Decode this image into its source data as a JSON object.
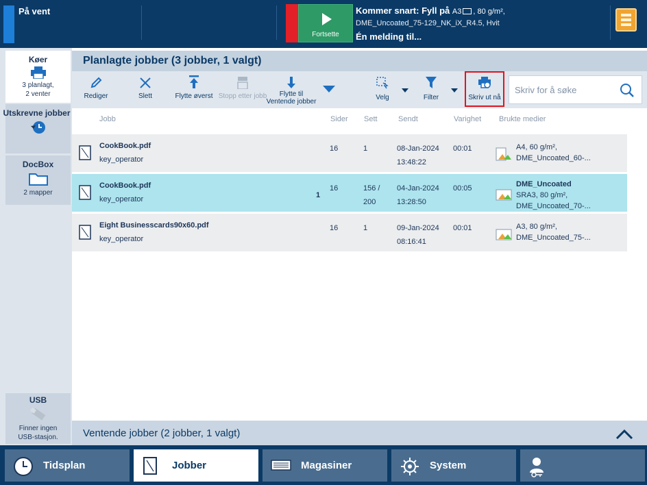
{
  "status": {
    "title": "På vent"
  },
  "printer": {
    "continue_label": "Fortsette",
    "msg_prefix": "Kommer snart: Fyll på",
    "msg_paper": "A3",
    "msg_spec": ", 80 g/m²,",
    "msg_line2": "DME_Uncoated_75-129_NK_iX_R4.5, Hvit",
    "msg_line3": "Én melding til..."
  },
  "sidebar": {
    "queues": {
      "title": "Køer",
      "sub1": "3 planlagt,",
      "sub2": "2 venter"
    },
    "printed": {
      "title": "Utskrevne jobber"
    },
    "docbox": {
      "title": "DocBox",
      "sub": "2 mapper"
    },
    "usb": {
      "title": "USB",
      "sub1": "Finner ingen",
      "sub2": "USB-stasjon."
    }
  },
  "panel": {
    "title": "Planlagte jobber (3 jobber, 1 valgt)"
  },
  "toolbar": {
    "edit": "Rediger",
    "delete": "Slett",
    "move_top": "Flytte øverst",
    "stop_after": "Stopp etter jobb",
    "move_to_1": "Flytte til",
    "move_to_2": "Ventende jobber",
    "select": "Velg",
    "filter": "Filter",
    "print_now": "Skriv ut nå"
  },
  "search": {
    "placeholder": "Skriv for å søke"
  },
  "columns": {
    "job": "Jobb",
    "pages": "Sider",
    "sets": "Sett",
    "sent": "Sendt",
    "duration": "Varighet",
    "media": "Brukte medier"
  },
  "jobs": [
    {
      "name": "CookBook.pdf",
      "owner": "key_operator",
      "count": "",
      "pages": "16",
      "sets": "1",
      "sets2": "",
      "date": "08-Jan-2024",
      "time": "13:48:22",
      "duration": "00:01",
      "media_bold": "",
      "media1": "A4, 60 g/m²,",
      "media2": "DME_Uncoated_60-..."
    },
    {
      "name": "CookBook.pdf",
      "owner": "key_operator",
      "count": "1",
      "pages": "16",
      "sets": "156 /",
      "sets2": "200",
      "date": "04-Jan-2024",
      "time": "13:28:50",
      "duration": "00:05",
      "media_bold": "DME_Uncoated",
      "media1": "SRA3, 80 g/m²,",
      "media2": "DME_Uncoated_70-..."
    },
    {
      "name": "Eight Businesscards90x60.pdf",
      "owner": "key_operator",
      "count": "",
      "pages": "16",
      "sets": "1",
      "sets2": "",
      "date": "09-Jan-2024",
      "time": "08:16:41",
      "duration": "00:01",
      "media_bold": "",
      "media1": "A3, 80 g/m²,",
      "media2": "DME_Uncoated_75-..."
    }
  ],
  "waiting": {
    "title": "Ventende jobber (2 jobber, 1 valgt)"
  },
  "nav": {
    "schedule": "Tidsplan",
    "jobs": "Jobber",
    "trays": "Magasiner",
    "system": "System"
  },
  "colors": {
    "topbar": "#0b3a66",
    "selected_row": "#ade4ee",
    "highlight": "#e0141e",
    "continue": "#2e9a66",
    "menu": "#f0a431"
  }
}
